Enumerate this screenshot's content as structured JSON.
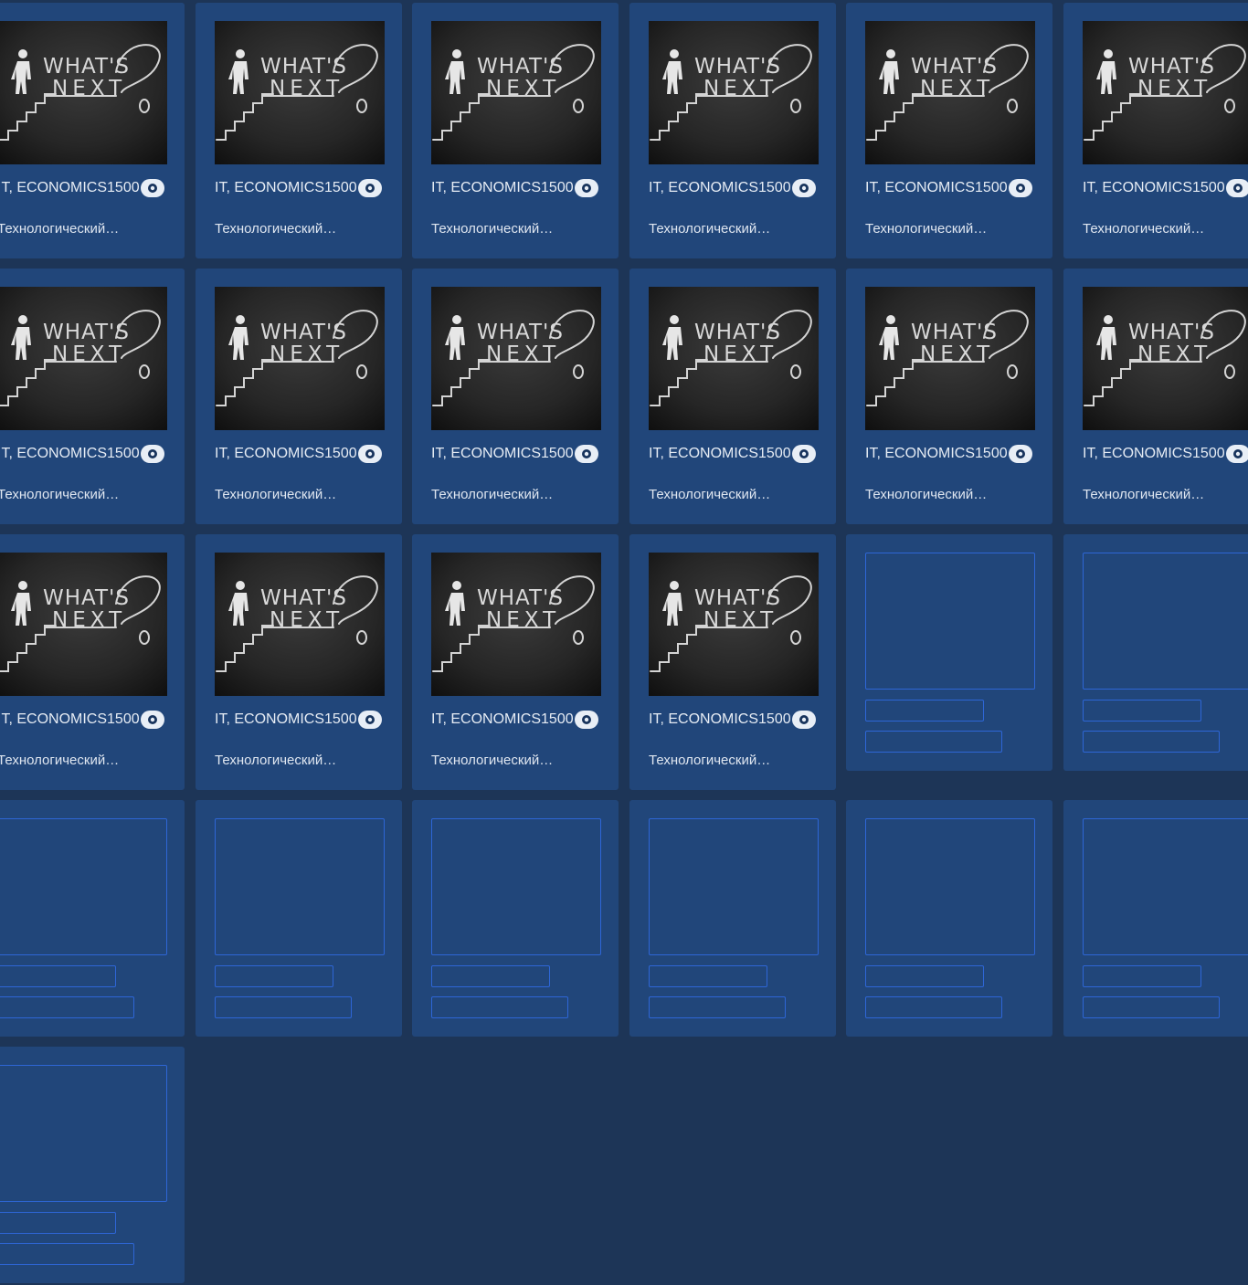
{
  "grid": {
    "columns": 6,
    "card_tags": "IT, ECONOMICS",
    "card_views": "1500",
    "card_title": "Технологический…",
    "thumbnail": {
      "line1": "WHAT'S",
      "line2": "NEXT",
      "mark": "?"
    },
    "filled_cards": 16,
    "placeholder_cards": 9
  }
}
